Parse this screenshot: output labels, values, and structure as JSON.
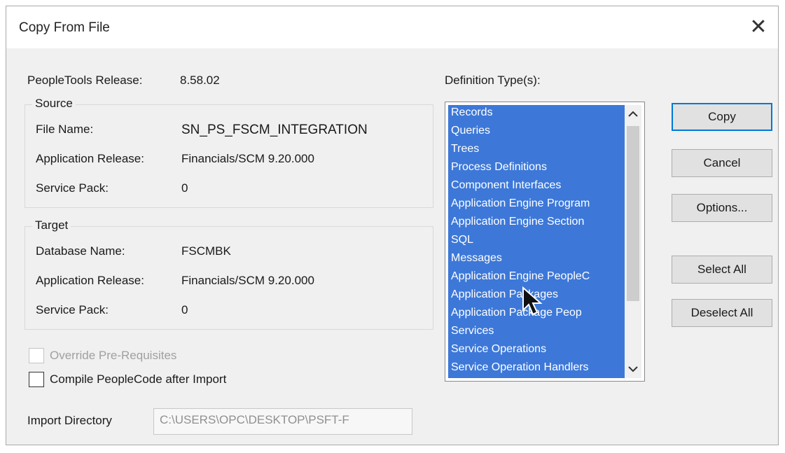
{
  "window": {
    "title": "Copy From File",
    "close_glyph": "✕"
  },
  "peopletools": {
    "label": "PeopleTools Release:",
    "value": "8.58.02"
  },
  "source": {
    "title": "Source",
    "file_name_label": "File Name:",
    "file_name_value": "SN_PS_FSCM_INTEGRATION",
    "app_release_label": "Application Release:",
    "app_release_value": "Financials/SCM 9.20.000",
    "service_pack_label": "Service Pack:",
    "service_pack_value": "0"
  },
  "target": {
    "title": "Target",
    "db_name_label": "Database Name:",
    "db_name_value": "FSCMBK",
    "app_release_label": "Application Release:",
    "app_release_value": "Financials/SCM 9.20.000",
    "service_pack_label": "Service Pack:",
    "service_pack_value": "0"
  },
  "options": {
    "override_label": "Override Pre-Requisites",
    "override_checked": false,
    "override_enabled": false,
    "compile_label": "Compile PeopleCode after Import",
    "compile_checked": false
  },
  "import_directory": {
    "label": "Import Directory",
    "value": "C:\\USERS\\OPC\\DESKTOP\\PSFT-F"
  },
  "definition_types": {
    "label": "Definition Type(s):",
    "items": [
      "Records",
      "Queries",
      "Trees",
      "Process Definitions",
      "Component Interfaces",
      "Application Engine Program",
      "Application Engine Section",
      "SQL",
      "Messages",
      "Application Engine PeopleC",
      "Application Packages",
      "Application Package Peop",
      "Services",
      "Service Operations",
      "Service Operation Handlers"
    ],
    "all_selected": true,
    "scroll_up_icon": "chevron-up-icon",
    "scroll_down_icon": "chevron-down-icon"
  },
  "buttons": {
    "copy": "Copy",
    "cancel": "Cancel",
    "options": "Options...",
    "select_all": "Select All",
    "deselect_all": "Deselect All"
  },
  "colors": {
    "selection": "#3d78d8",
    "focus_border": "#0078d7"
  }
}
